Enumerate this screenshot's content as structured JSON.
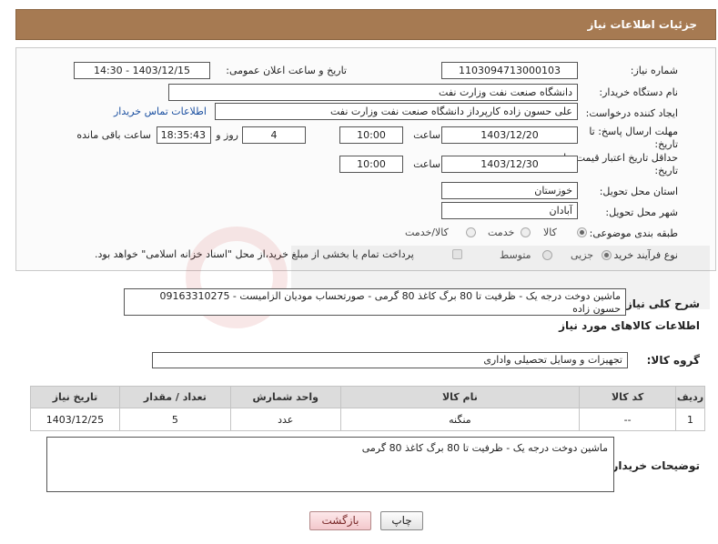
{
  "header": {
    "title": "جزئیات اطلاعات نیاز"
  },
  "form": {
    "need_number_label": "شماره نیاز:",
    "need_number": "1103094713000103",
    "announce_label": "تاریخ و ساعت اعلان عمومی:",
    "announce_value": "1403/12/15 - 14:30",
    "buyer_org_label": "نام دستگاه خریدار:",
    "buyer_org": "دانشگاه صنعت نفت وزارت نفت",
    "creator_label": "ایجاد کننده درخواست:",
    "creator": "علی حسون زاده کارپرداز دانشگاه صنعت نفت وزارت نفت",
    "contact_link": "اطلاعات تماس خریدار",
    "deadline_label_1": "مهلت ارسال پاسخ: تا",
    "deadline_label_2": "تاریخ:",
    "deadline_date": "1403/12/20",
    "time_label": "ساعت",
    "deadline_time": "10:00",
    "days_value": "4",
    "days_label": "روز و",
    "remaining_time": "18:35:43",
    "remaining_label": "ساعت باقی مانده",
    "validity_label_1": "حداقل تاریخ اعتبار قیمت: تا",
    "validity_label_2": "تاریخ:",
    "validity_date": "1403/12/30",
    "validity_time": "10:00",
    "province_label": "استان محل تحویل:",
    "province": "خوزستان",
    "city_label": "شهر محل تحویل:",
    "city": "آبادان",
    "category_label": "طبقه بندی موضوعی:",
    "category_options": [
      "کالا",
      "خدمت",
      "کالا/خدمت"
    ],
    "process_label": "نوع فرآیند خرید :",
    "process_options": [
      "جزیی",
      "متوسط"
    ],
    "payment_note": "پرداخت تمام یا بخشی از مبلغ خرید،از محل \"اسناد خزانه اسلامی\" خواهد بود."
  },
  "description": {
    "label": "شرح کلی نیاز:",
    "text": "ماشین دوخت درجه یک - ظرفیت تا 80 برگ کاغذ 80 گرمی - صورتحساب مودیان الزامیست - 09163310275 حسون زاده"
  },
  "goods_section_title": "اطلاعات کالاهای مورد نیاز",
  "goods_group_label": "گروه کالا:",
  "goods_group": "تجهیزات و وسایل تحصیلی واداری",
  "table": {
    "headers": [
      "ردیف",
      "کد کالا",
      "نام کالا",
      "واحد شمارش",
      "تعداد / مقدار",
      "تاریخ نیاز"
    ],
    "rows": [
      [
        "1",
        "--",
        "منگنه",
        "عدد",
        "5",
        "1403/12/25"
      ]
    ]
  },
  "buyer_notes": {
    "label": "توضیحات خریدار:",
    "text": "ماشین دوخت درجه یک - ظرفیت تا 80 برگ کاغذ 80 گرمی"
  },
  "buttons": {
    "print": "چاپ",
    "back": "بازگشت"
  },
  "colors": {
    "header": "#a67a52",
    "link": "#1a4fa0"
  }
}
